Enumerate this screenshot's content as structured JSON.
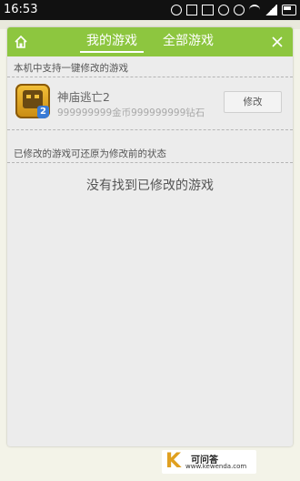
{
  "status_bar": {
    "time": "16:53"
  },
  "header": {
    "tabs": [
      {
        "label": "我的游戏",
        "active": true
      },
      {
        "label": "全部游戏",
        "active": false
      }
    ],
    "accent_color": "#8dc63f"
  },
  "supported_section": {
    "label": "本机中支持一键修改的游戏",
    "games": [
      {
        "name": "神庙逃亡2",
        "stats": "999999999金币999999999钻石",
        "action_label": "修改",
        "icon": "temple-run-2-icon",
        "icon_badge": "2"
      }
    ]
  },
  "modified_section": {
    "label": "已修改的游戏可还原为修改前的状态",
    "empty_message": "没有找到已修改的游戏"
  },
  "watermark": {
    "logo_letter": "K",
    "title": "可问答",
    "url": "www.kewenda.com"
  }
}
